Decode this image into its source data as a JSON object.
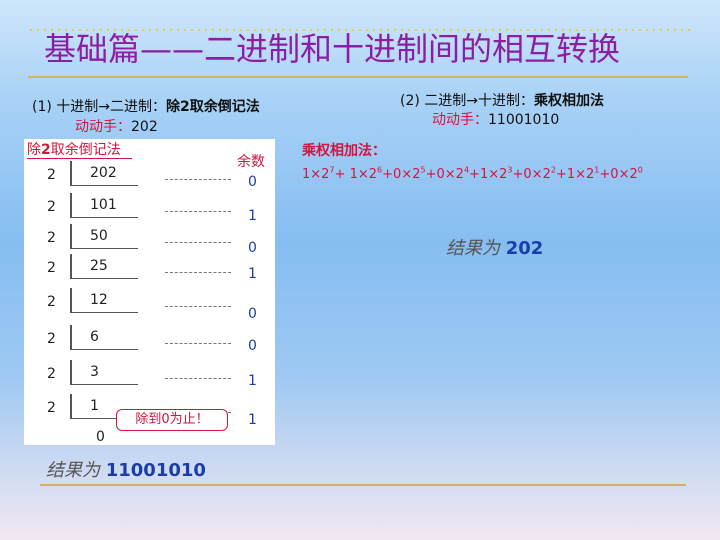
{
  "title": "基础篇——二进制和十进制间的相互转换",
  "section1": {
    "heading": "(1) 十进制→二进制：",
    "heading_bold": "除2取余倒记法",
    "prompt": "动动手：",
    "value": "202"
  },
  "section2": {
    "heading": "(2) 二进制→十进制：",
    "heading_bold": "乘权相加法",
    "prompt": "动动手：",
    "value": "11001010"
  },
  "panel": {
    "title_pre": "除",
    "title_num": "2",
    "title_post": "取余倒记法",
    "remainder_header": "余数",
    "rows": [
      {
        "divisor": "2",
        "quotient": "202",
        "remainder": "0"
      },
      {
        "divisor": "2",
        "quotient": "101",
        "remainder": "1"
      },
      {
        "divisor": "2",
        "quotient": "50",
        "remainder": "0"
      },
      {
        "divisor": "2",
        "quotient": "25",
        "remainder": "1"
      },
      {
        "divisor": "2",
        "quotient": "12",
        "remainder": "0"
      },
      {
        "divisor": "2",
        "quotient": "6",
        "remainder": "0"
      },
      {
        "divisor": "2",
        "quotient": "3",
        "remainder": "1"
      },
      {
        "divisor": "2",
        "quotient": "1",
        "remainder": "1"
      }
    ],
    "final_quotient": "0",
    "callout": "除到0为止！"
  },
  "formula": {
    "label": "乘权相加法：",
    "terms": [
      {
        "coef": "1",
        "exp": "7",
        "sep": "+ "
      },
      {
        "coef": "1",
        "exp": "6",
        "sep": "+"
      },
      {
        "coef": "0",
        "exp": "5",
        "sep": "+"
      },
      {
        "coef": "0",
        "exp": "4",
        "sep": "+"
      },
      {
        "coef": "1",
        "exp": "3",
        "sep": "+"
      },
      {
        "coef": "0",
        "exp": "2",
        "sep": "+"
      },
      {
        "coef": "1",
        "exp": "1",
        "sep": "+"
      },
      {
        "coef": "0",
        "exp": "0",
        "sep": ""
      }
    ],
    "times": "×2"
  },
  "result1": {
    "label": "结果为 ",
    "value": "11001010"
  },
  "result2": {
    "label": "结果为 ",
    "value": "202"
  },
  "colors": {
    "title": "#8b1fa3",
    "accent_red": "#d4143c",
    "remainder_blue": "#1a3ea8",
    "rule_gold": "#d9b35a"
  }
}
